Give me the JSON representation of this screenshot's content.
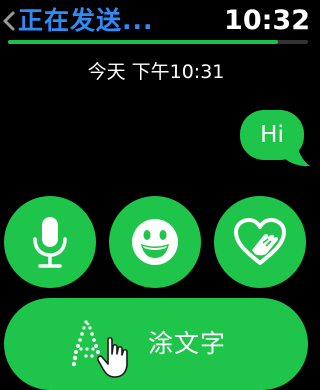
{
  "header": {
    "title": "正在发送...",
    "time": "10:32",
    "progress": 0.9
  },
  "conversation": {
    "timestamp": "今天 下午10:31",
    "messages": [
      {
        "text": "Hi",
        "from": "me"
      }
    ]
  },
  "actions": {
    "dictation": {
      "icon": "microphone-icon"
    },
    "emoji": {
      "icon": "smiley-face-icon"
    },
    "digital_touch": {
      "icon": "heart-touch-icon"
    },
    "scribble": {
      "icon": "scribble-hand-icon",
      "label": "涂文字"
    }
  },
  "colors": {
    "accent_green": "#1ec54a",
    "title_blue": "#2f8cf7",
    "background": "#000000"
  }
}
